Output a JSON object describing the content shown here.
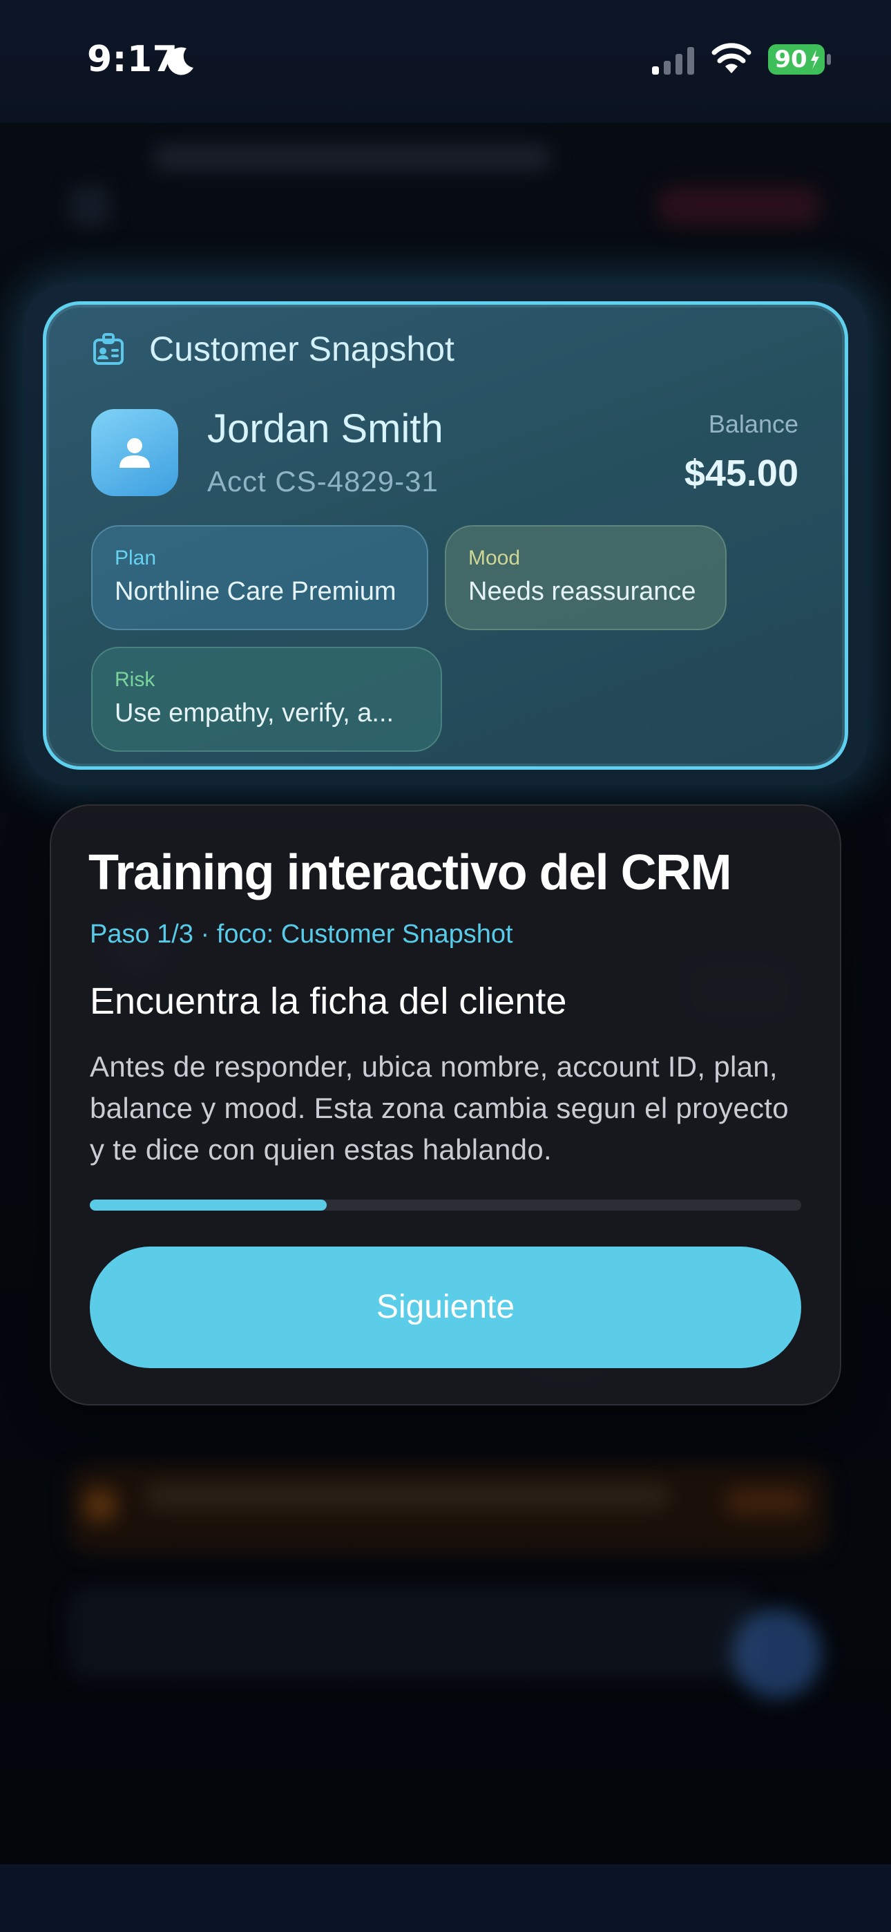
{
  "status_bar": {
    "time": "9:17",
    "battery": "90",
    "icons": [
      "moon-icon",
      "signal-icon",
      "wifi-icon",
      "battery-icon"
    ]
  },
  "customer_snapshot": {
    "title": "Customer Snapshot",
    "icon": "id-badge-icon",
    "name": "Jordan Smith",
    "account": "Acct CS-4829-31",
    "balance_label": "Balance",
    "balance_value": "$45.00",
    "chips": {
      "plan": {
        "label": "Plan",
        "value": "Northline Care Premium"
      },
      "mood": {
        "label": "Mood",
        "value": "Needs reassurance"
      },
      "risk": {
        "label": "Risk",
        "value": "Use empathy, verify, a..."
      }
    }
  },
  "training": {
    "title": "Training interactivo del CRM",
    "step": "Paso 1/3 · foco: Customer Snapshot",
    "heading": "Encuentra la ficha del cliente",
    "description": "Antes de responder, ubica nombre, account ID, plan, balance y mood. Esta zona cambia segun el proyecto y te dice con quien estas hablando.",
    "progress": 0.333,
    "next_label": "Siguiente"
  },
  "colors": {
    "accent": "#5ccde9",
    "card_border": "#5fd0ee",
    "training_bg": "#181a20"
  }
}
